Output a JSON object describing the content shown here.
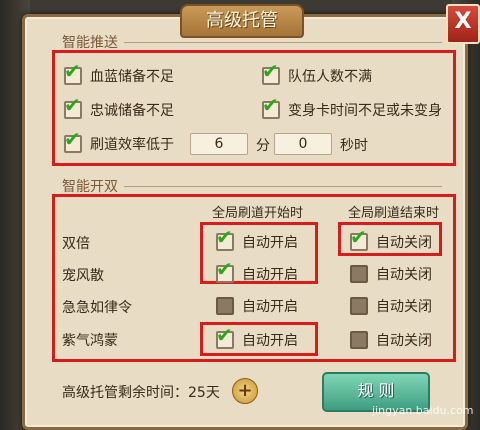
{
  "dialog": {
    "title": "高级托管",
    "close_label": "X"
  },
  "smart_push": {
    "title": "智能推送",
    "options": [
      {
        "label": "血蓝储备不足",
        "checked": true
      },
      {
        "label": "队伍人数不满",
        "checked": true
      },
      {
        "label": "忠诚储备不足",
        "checked": true
      },
      {
        "label": "变身卡时间不足或未变身",
        "checked": true
      },
      {
        "label": "刷道效率低于",
        "checked": true
      }
    ],
    "minutes_value": "6",
    "minutes_unit": "分",
    "seconds_value": "0",
    "seconds_unit": "秒时"
  },
  "smart_double": {
    "title": "智能开双",
    "col_start": "全局刷道开始时",
    "col_end": "全局刷道结束时",
    "rows": [
      {
        "label": "双倍",
        "start": {
          "text": "自动开启",
          "checked": true
        },
        "end": {
          "text": "自动关闭",
          "checked": true
        }
      },
      {
        "label": "宠风散",
        "start": {
          "text": "自动开启",
          "checked": true
        },
        "end": {
          "text": "自动关闭",
          "checked": false
        }
      },
      {
        "label": "急急如律令",
        "start": {
          "text": "自动开启",
          "checked": false
        },
        "end": {
          "text": "自动关闭",
          "checked": false
        }
      },
      {
        "label": "紫气鸿蒙",
        "start": {
          "text": "自动开启",
          "checked": true
        },
        "end": {
          "text": "自动关闭",
          "checked": false
        }
      }
    ]
  },
  "footer": {
    "remaining_label": "高级托管剩余时间：25天",
    "plus_label": "+",
    "rule_button": "规 则"
  },
  "watermark": "jingyan.baidu.com",
  "colors": {
    "check": "#2aa81a",
    "highlight": "#d81c1c",
    "panel": "#e8dcc4",
    "rule_button": "#3f9e80"
  }
}
